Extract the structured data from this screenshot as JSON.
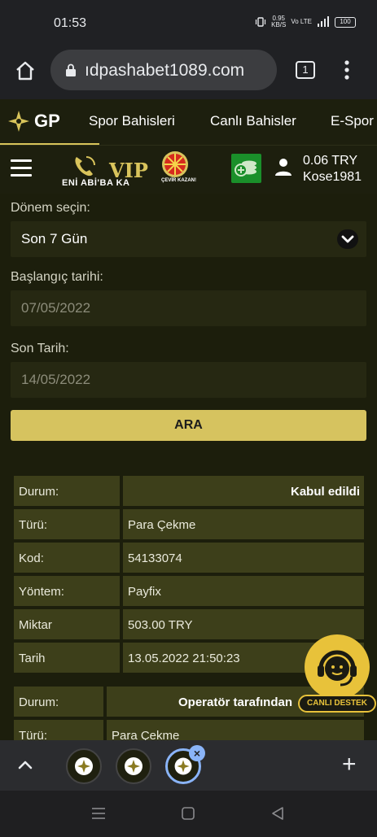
{
  "status_bar": {
    "time": "01:53",
    "speed_value": "0.95",
    "speed_unit": "KB/S",
    "network": "Vo LTE",
    "battery": "100"
  },
  "browser": {
    "url": "ıdpashabet1089.com",
    "tab_count": "1"
  },
  "site_nav": {
    "logo": "GP",
    "items": [
      "Spor Bahisleri",
      "Canlı Bahisler",
      "E-Spor"
    ]
  },
  "sub_bar": {
    "promo_text": "ENİ ABİ'BA KA",
    "promo_vip": "VIP",
    "promo_cevir": "ÇEVİR KAZAN!",
    "balance": "0.06 TRY",
    "username": "Kose1981"
  },
  "filter": {
    "period_label": "Dönem seçin:",
    "period_value": "Son 7 Gün",
    "start_label": "Başlangıç tarihi:",
    "start_value": "07/05/2022",
    "end_label": "Son Tarih:",
    "end_value": "14/05/2022",
    "search_button": "ARA"
  },
  "records": [
    {
      "rows": [
        {
          "key": "Durum:",
          "value": "Kabul edildi"
        },
        {
          "key": "Türü:",
          "value": "Para Çekme"
        },
        {
          "key": "Kod:",
          "value": "54133074"
        },
        {
          "key": "Yöntem:",
          "value": "Payfix"
        },
        {
          "key": "Miktar",
          "value": "503.00 TRY"
        },
        {
          "key": "Tarih",
          "value": "13.05.2022 21:50:23"
        }
      ]
    },
    {
      "rows": [
        {
          "key": "Durum:",
          "value": "Operatör tarafından"
        },
        {
          "key": "Türü:",
          "value": "Para Çekme"
        }
      ]
    }
  ],
  "support": {
    "label": "CANLI DESTEK"
  },
  "tab_strip": {
    "close_symbol": "×",
    "new_tab_symbol": "+"
  },
  "colors": {
    "accent": "#d6c35f",
    "page_bg": "#1c1e0c",
    "table_cell": "#3d3f1a",
    "support_yellow": "#e8c23a"
  }
}
